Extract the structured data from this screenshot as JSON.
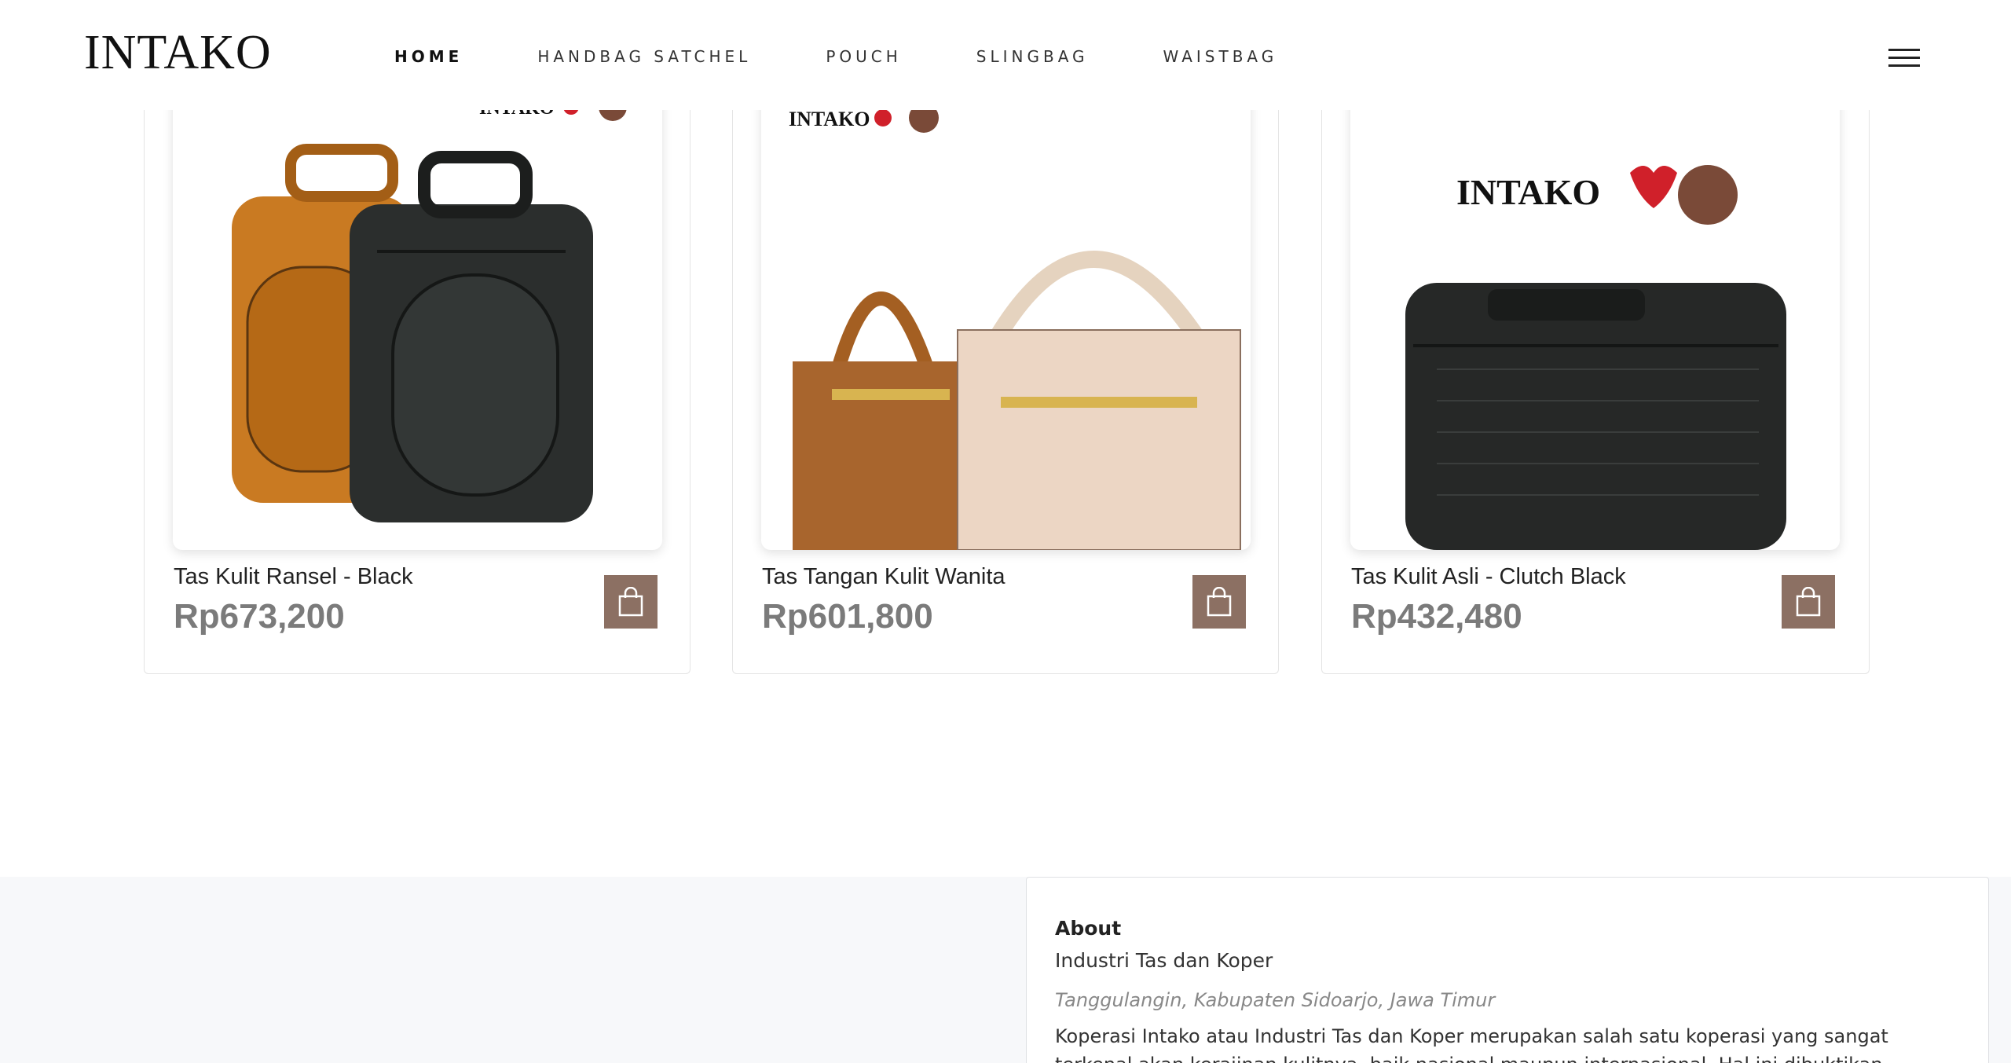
{
  "brand": {
    "logo_text": "INTAKO"
  },
  "nav": {
    "items": [
      {
        "label": "HOME",
        "active": true
      },
      {
        "label": "HANDBAG SATCHEL",
        "active": false
      },
      {
        "label": "POUCH",
        "active": false
      },
      {
        "label": "SLINGBAG",
        "active": false
      },
      {
        "label": "WAISTBAG",
        "active": false
      }
    ]
  },
  "products": [
    {
      "name": "Tas Kulit Ransel - Black",
      "price": "Rp673,200",
      "photo_logo": "INTAKO"
    },
    {
      "name": "Tas Tangan Kulit Wanita",
      "price": "Rp601,800",
      "photo_logo": "INTAKO"
    },
    {
      "name": "Tas Kulit Asli - Clutch Black",
      "price": "Rp432,480",
      "photo_logo": "INTAKO"
    }
  ],
  "about": {
    "title": "About",
    "subtitle": "Industri Tas dan Koper",
    "location": "Tanggulangin, Kabupaten Sidoarjo, Jawa Timur",
    "description": "Koperasi Intako atau Industri Tas dan Koper merupakan salah satu koperasi yang sangat terkenal akan kerajinan kulitnya, baik nasional maupun internasional. Hal ini dibuktikan dengan adanya"
  },
  "colors": {
    "accent": "#8c7063",
    "price": "#7b7b7b",
    "footer_bg": "#f7f8fa"
  },
  "icons": {
    "cart": "shopping-bag-icon",
    "menu": "hamburger-menu-icon"
  }
}
